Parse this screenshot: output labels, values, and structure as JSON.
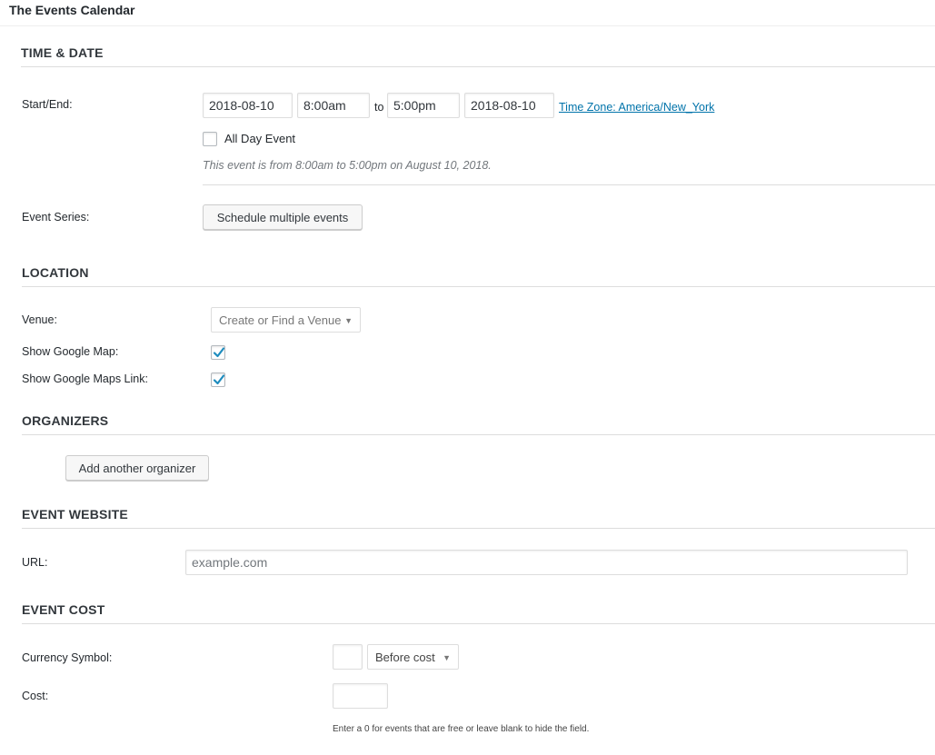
{
  "box_title": "The Events Calendar",
  "time_date": {
    "section_title": "TIME & DATE",
    "start_end_label": "Start/End:",
    "start_date": "2018-08-10",
    "start_time": "8:00am",
    "to_label": "to",
    "end_time": "5:00pm",
    "end_date": "2018-08-10",
    "timezone_link": "Time Zone: America/New_York",
    "all_day_label": "All Day Event",
    "all_day_checked": false,
    "summary": "This event is from 8:00am to 5:00pm on August 10, 2018.",
    "event_series_label": "Event Series:",
    "schedule_button": "Schedule multiple events"
  },
  "location": {
    "section_title": "LOCATION",
    "venue_label": "Venue:",
    "venue_select_placeholder": "Create or Find a Venue",
    "show_map_label": "Show Google Map:",
    "show_map_checked": true,
    "show_map_link_label": "Show Google Maps Link:",
    "show_map_link_checked": true
  },
  "organizers": {
    "section_title": "ORGANIZERS",
    "add_button": "Add another organizer"
  },
  "website": {
    "section_title": "EVENT WEBSITE",
    "url_label": "URL:",
    "url_placeholder": "example.com"
  },
  "cost": {
    "section_title": "EVENT COST",
    "currency_label": "Currency Symbol:",
    "currency_value": "",
    "position_select": "Before cost",
    "cost_label": "Cost:",
    "cost_value": "",
    "helper": "Enter a 0 for events that are free or leave blank to hide the field."
  },
  "colors": {
    "link": "#0073aa",
    "check": "#1e8cbe",
    "rule": "#dddddd"
  }
}
